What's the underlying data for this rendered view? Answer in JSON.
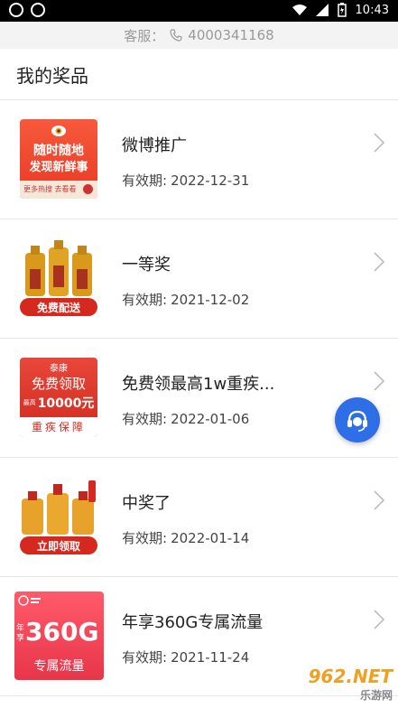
{
  "status": {
    "time": "10:43"
  },
  "service": {
    "label": "客服：",
    "phone": "4000341168"
  },
  "section": {
    "title": "我的奖品"
  },
  "prizes": [
    {
      "title": "微博推广",
      "expiry_label": "有效期:",
      "expiry": "2022-12-31",
      "thumb": {
        "line1": "随时随地",
        "line2": "发现新鲜事",
        "footer": "更多热搜 去看看"
      }
    },
    {
      "title": "一等奖",
      "expiry_label": "有效期:",
      "expiry": "2021-12-02",
      "thumb": {
        "badge": "免费配送"
      }
    },
    {
      "title": "免费领最高1w重疾...",
      "expiry_label": "有效期:",
      "expiry": "2022-01-06",
      "thumb": {
        "brand": "泰康",
        "line1": "免费领取",
        "small": "最高",
        "amount": "10000元",
        "footer": "重疾保障"
      }
    },
    {
      "title": "中奖了",
      "expiry_label": "有效期:",
      "expiry": "2022-01-14",
      "thumb": {
        "badge": "立即领取"
      }
    },
    {
      "title": "年享360G专属流量",
      "expiry_label": "有效期:",
      "expiry": "2021-11-24",
      "thumb": {
        "side": "年享",
        "big": "360G",
        "footer": "专属流量"
      }
    }
  ],
  "watermark": {
    "brand": "962.NET",
    "sub": "乐游网"
  },
  "colors": {
    "accent": "#2e6ee6",
    "red": "#e03a2f",
    "gold": "#d99a1c"
  }
}
